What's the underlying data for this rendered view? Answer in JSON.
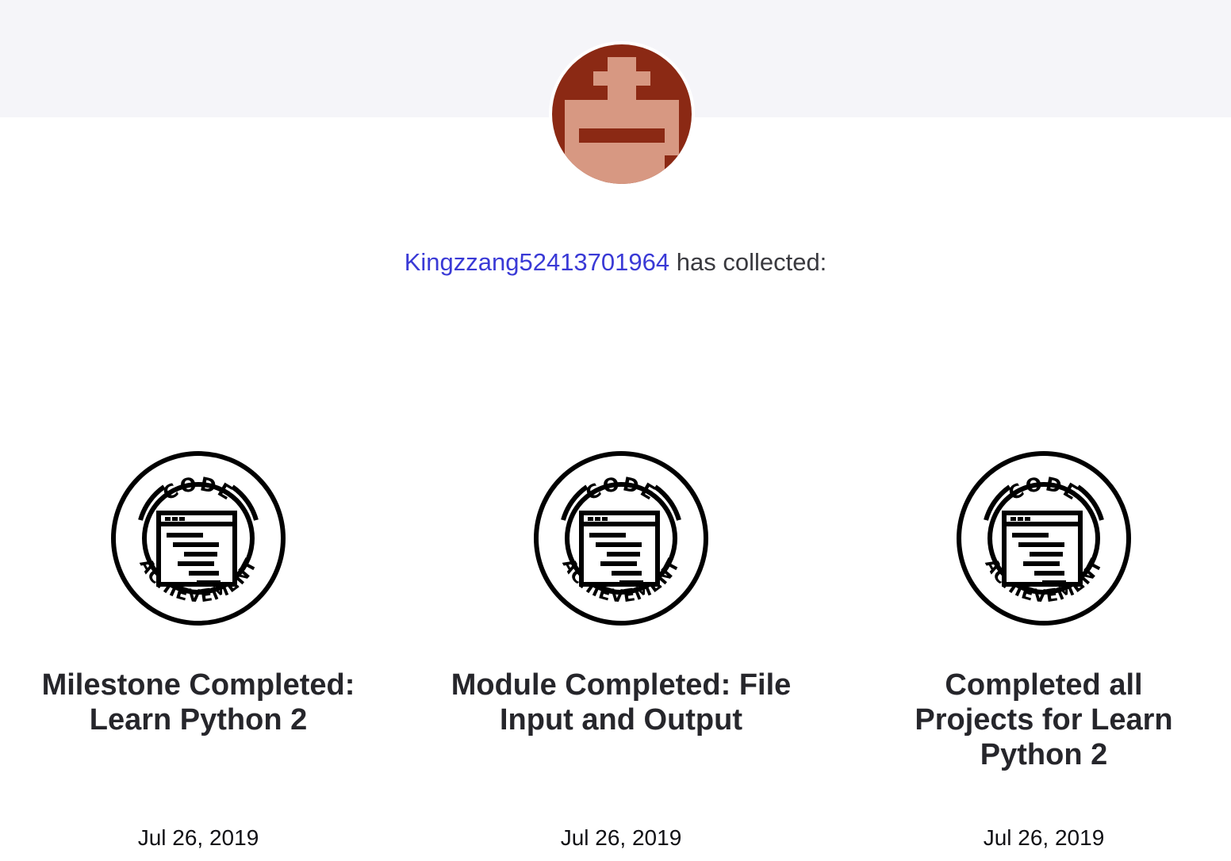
{
  "profile": {
    "username": "Kingzzang52413701964",
    "collected_text": " has collected:",
    "avatar_colors": {
      "background": "#8b2914",
      "skin": "#d79882"
    }
  },
  "achievements": [
    {
      "badge_top_text": "CODE",
      "badge_bottom_text": "ACHIEVEMENT",
      "title": "Milestone Completed: Learn Python 2",
      "date": "Jul 26, 2019"
    },
    {
      "badge_top_text": "CODE",
      "badge_bottom_text": "ACHIEVEMENT",
      "title": "Module Completed: File Input and Output",
      "date": "Jul 26, 2019"
    },
    {
      "badge_top_text": "CODE",
      "badge_bottom_text": "ACHIEVEMENT",
      "title": "Completed all Projects for Learn Python 2",
      "date": "Jul 26, 2019"
    }
  ]
}
